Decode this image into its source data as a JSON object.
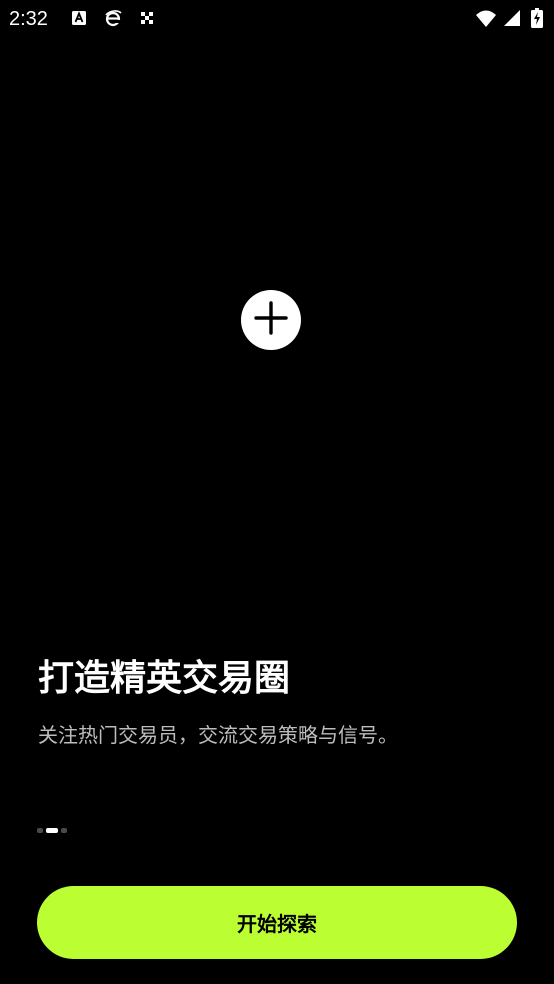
{
  "status_bar": {
    "time": "2:32",
    "notification_icons": [
      "font-a-icon",
      "browser-e-icon",
      "scan-icon"
    ],
    "system_icons": [
      "wifi-icon",
      "cell-signal-icon",
      "battery-charging-icon"
    ]
  },
  "onboarding": {
    "center_icon": "plus-icon",
    "title": "打造精英交易圈",
    "subtitle": "关注热门交易员，交流交易策略与信号。",
    "pager": {
      "total": 3,
      "active_index": 1
    },
    "cta_label": "开始探索"
  },
  "colors": {
    "background": "#000000",
    "accent": "#bbff33",
    "title": "#ffffff",
    "subtitle": "#bdbdbd"
  }
}
